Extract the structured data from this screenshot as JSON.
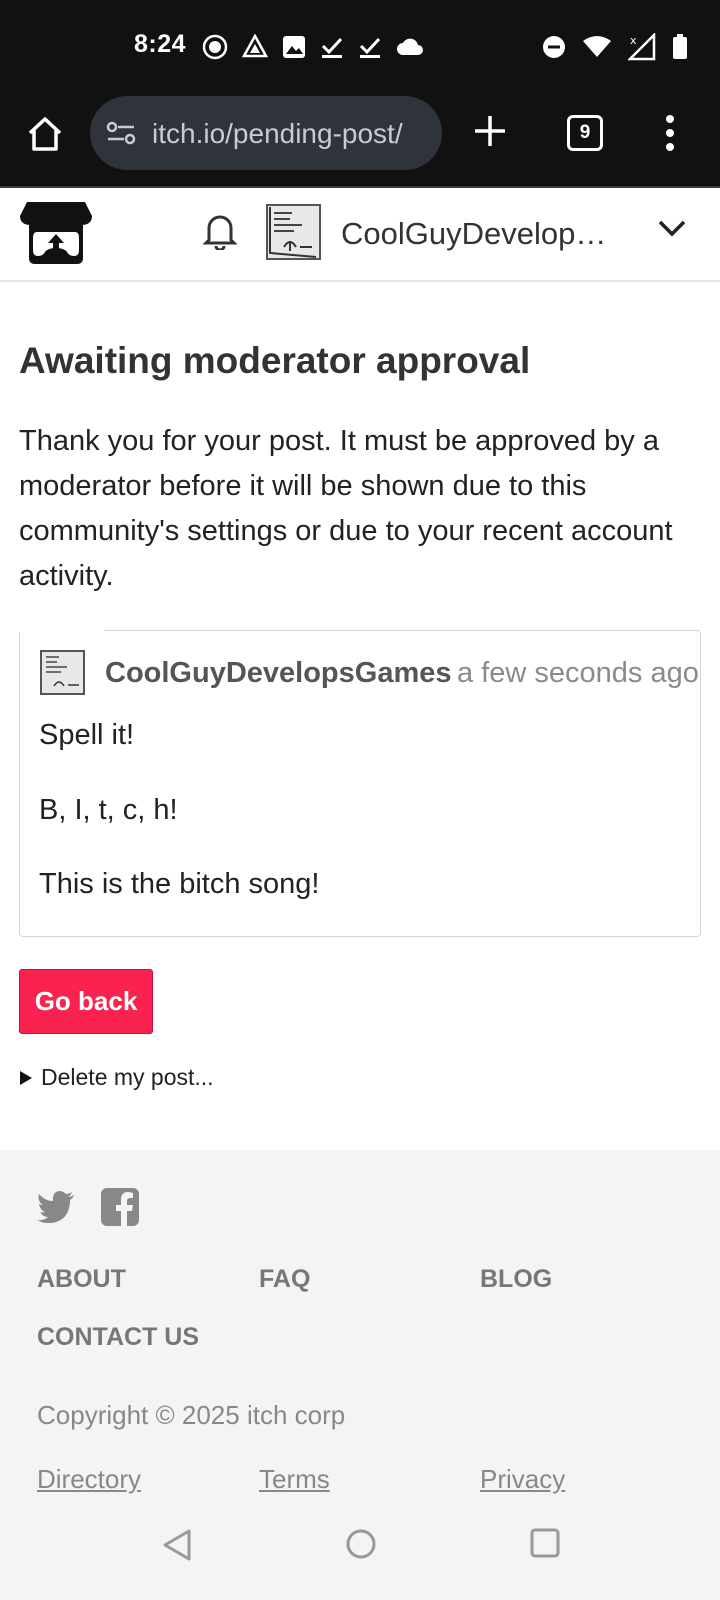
{
  "status_bar": {
    "time": "8:24",
    "left_icons": [
      "record-icon",
      "drive-icon",
      "image-icon",
      "check-icon",
      "check-icon",
      "cloud-icon"
    ],
    "right_icons": [
      "do-not-disturb-icon",
      "wifi-icon",
      "signal-icon",
      "battery-icon"
    ]
  },
  "browser": {
    "url": "itch.io/pending-post/",
    "tab_count": "9"
  },
  "header": {
    "username": "CoolGuyDevelops..."
  },
  "page": {
    "title": "Awaiting moderator approval",
    "description": "Thank you for your post. It must be approved by a moderator before it will be shown due to this community's settings or due to your recent account activity."
  },
  "post": {
    "author": "CoolGuyDevelopsGames",
    "time": "a few seconds ago",
    "lines": [
      "Spell it!",
      "B, I, t, c, h!",
      "This is the bitch song!"
    ]
  },
  "actions": {
    "go_back": "Go back",
    "delete": "Delete my post..."
  },
  "footer": {
    "links": [
      "ABOUT",
      "FAQ",
      "BLOG",
      "CONTACT US"
    ],
    "copyright": "Copyright © 2025 itch corp",
    "bottom_links": [
      "Directory",
      "Terms",
      "Privacy"
    ]
  },
  "colors": {
    "accent": "#fa2350",
    "status_bar": "#111111",
    "url_pill": "#2e333c"
  }
}
